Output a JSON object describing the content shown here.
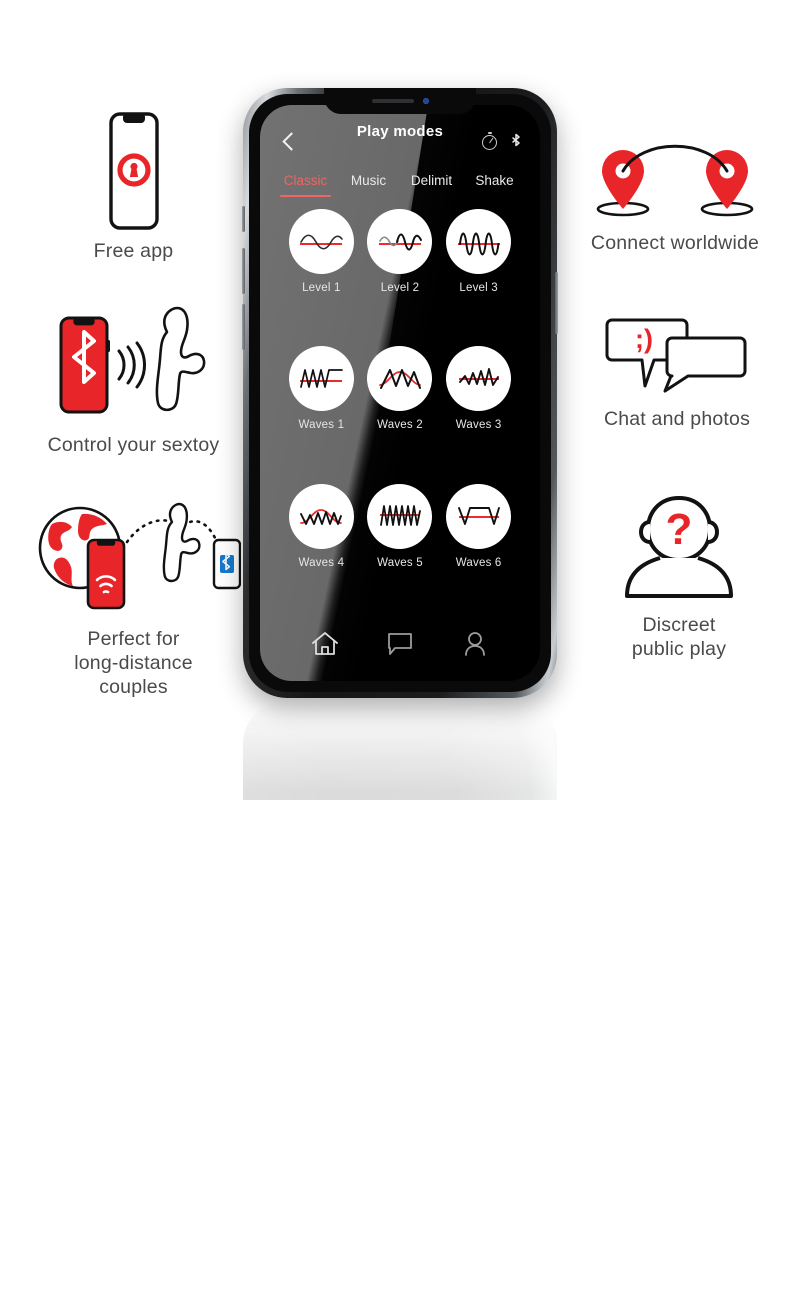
{
  "colors": {
    "brand_red": "#E8262A",
    "tab_active": "#F06464",
    "wave_red": "#EE2A2E",
    "caption_gray": "#4A4A4A",
    "bluetooth_blue": "#1878CE",
    "camera_blue": "#1D3F8A"
  },
  "phone_app": {
    "header": {
      "back_icon": "chevron-left-icon",
      "title": "Play modes",
      "battery_icon": "battery-circle-icon",
      "bluetooth_icon": "bluetooth-icon"
    },
    "tabs": [
      {
        "label": "Classic",
        "active": true
      },
      {
        "label": "Music",
        "active": false
      },
      {
        "label": "Delimit",
        "active": false
      },
      {
        "label": "Shake",
        "active": false
      }
    ],
    "modes": [
      {
        "label": "Level 1",
        "wave": "sine-low"
      },
      {
        "label": "Level 2",
        "wave": "sine-mid"
      },
      {
        "label": "Level 3",
        "wave": "sine-high"
      },
      {
        "label": "Waves 1",
        "wave": "ramp-flat"
      },
      {
        "label": "Waves 2",
        "wave": "zigzag-peak"
      },
      {
        "label": "Waves 3",
        "wave": "zigzag-rising"
      },
      {
        "label": "Waves 4",
        "wave": "zigzag-arc"
      },
      {
        "label": "Waves 5",
        "wave": "sawtooth"
      },
      {
        "label": "Waves 6",
        "wave": "square-step"
      }
    ],
    "bottom_nav": [
      {
        "icon": "home-icon",
        "label": "Home"
      },
      {
        "icon": "chat-bubble-icon",
        "label": "Chat"
      },
      {
        "icon": "profile-icon",
        "label": "Profile"
      }
    ]
  },
  "features": {
    "free_app": {
      "caption": "Free app",
      "art": "phone-with-app-logo"
    },
    "control_sextoy": {
      "caption": "Control your sextoy",
      "art": "red-phone-bluetooth-to-toy"
    },
    "long_distance": {
      "caption": "Perfect for\nlong-distance\ncouples",
      "art": "globe-phone-toy-phone"
    },
    "connect_worldwide": {
      "caption": "Connect worldwide",
      "art": "two-map-pins-arc"
    },
    "chat_photos": {
      "caption": "Chat and photos",
      "art": "two-speech-bubbles-wink",
      "emoticon": ";)"
    },
    "discreet": {
      "caption": "Discreet\npublic play",
      "art": "anonymous-person-question-mark"
    }
  }
}
